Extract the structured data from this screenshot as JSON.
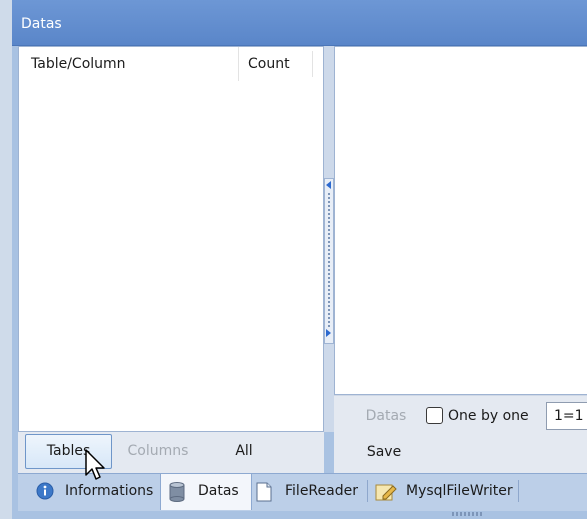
{
  "window": {
    "title": "Datas"
  },
  "left_panel": {
    "columns": [
      "Table/Column",
      "Count"
    ],
    "buttons": {
      "tables": "Tables",
      "columns": "Columns",
      "all": "All"
    }
  },
  "right_panel": {
    "datas_label": "Datas",
    "one_by_one_label": "One by one",
    "one_by_one_checked": false,
    "limit_value": "1=1",
    "save_label": "Save"
  },
  "tabs": [
    {
      "label": "Informations",
      "icon": "info-icon"
    },
    {
      "label": "Datas",
      "icon": "database-icon",
      "selected": true
    },
    {
      "label": "FileReader",
      "icon": "document-icon"
    },
    {
      "label": "MysqlFileWriter",
      "icon": "edit-document-icon"
    }
  ],
  "colors": {
    "title_bar": "#5f8bcc",
    "panel_bg": "#ffffff",
    "toolbar_bg": "#e4e9f1",
    "tab_strip": "#bccfe8",
    "accent": "#2d6ad0"
  }
}
